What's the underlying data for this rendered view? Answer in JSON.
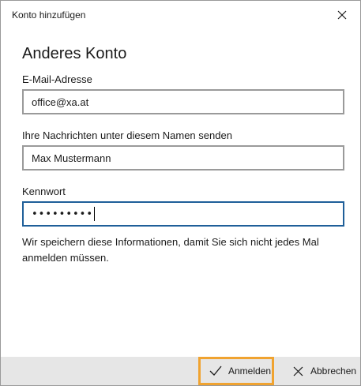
{
  "window": {
    "title": "Konto hinzufügen",
    "close_icon": "close-icon"
  },
  "form": {
    "heading": "Anderes Konto",
    "email": {
      "label": "E-Mail-Adresse",
      "value": "office@xa.at"
    },
    "sender_name": {
      "label": "Ihre Nachrichten unter diesem Namen senden",
      "value": "Max Mustermann"
    },
    "password": {
      "label": "Kennwort",
      "masked_value": "•••••••••"
    },
    "info_text": "Wir speichern diese Informationen, damit Sie sich nicht jedes Mal anmelden müssen."
  },
  "footer": {
    "signin_label": "Anmelden",
    "signin_icon": "checkmark-icon",
    "cancel_label": "Abbrechen",
    "cancel_icon": "close-icon"
  },
  "colors": {
    "focus_border": "#1f5f99",
    "highlight": "#f0a330",
    "footer_bg": "#e6e6e6"
  }
}
